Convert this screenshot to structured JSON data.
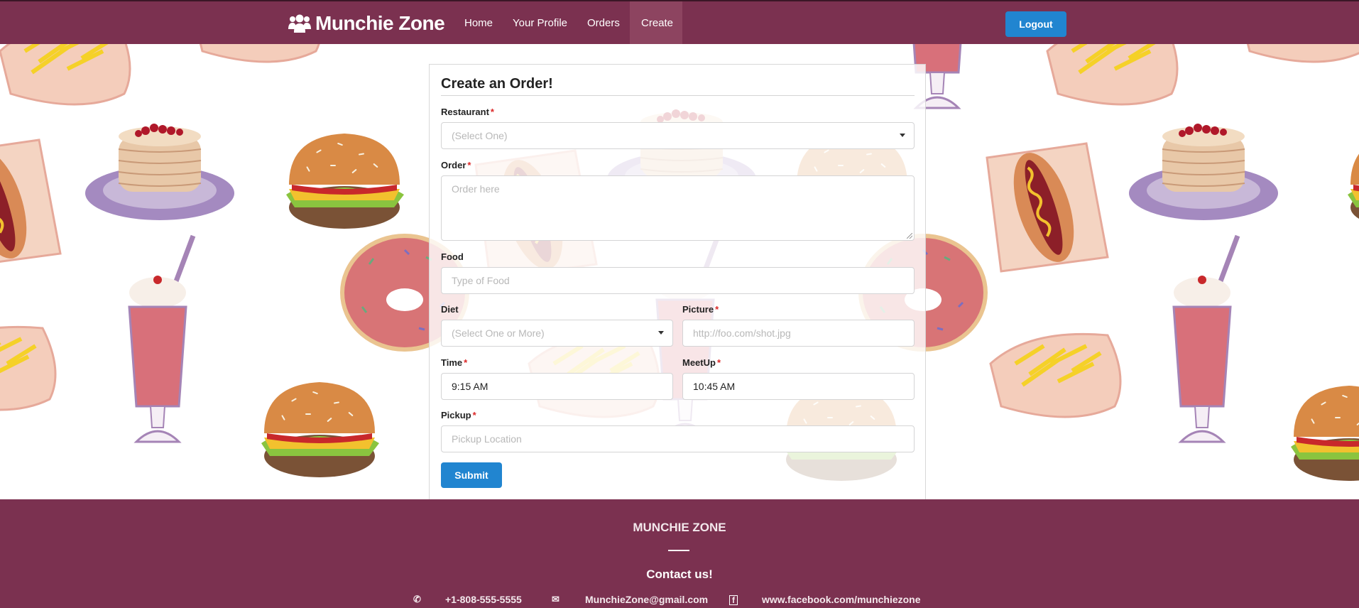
{
  "header": {
    "brand": "Munchie Zone",
    "nav": [
      "Home",
      "Your Profile",
      "Orders",
      "Create"
    ],
    "active_nav": "Create",
    "logout_label": "Logout"
  },
  "form": {
    "title": "Create an Order!",
    "restaurant": {
      "label": "Restaurant",
      "placeholder": "(Select One)"
    },
    "order": {
      "label": "Order",
      "placeholder": "Order here"
    },
    "food": {
      "label": "Food",
      "placeholder": "Type of Food"
    },
    "diet": {
      "label": "Diet",
      "placeholder": "(Select One or More)"
    },
    "picture": {
      "label": "Picture",
      "placeholder": "http://foo.com/shot.jpg"
    },
    "time": {
      "label": "Time",
      "value": "9:15 AM"
    },
    "meetup": {
      "label": "MeetUp",
      "value": "10:45 AM"
    },
    "pickup": {
      "label": "Pickup",
      "placeholder": "Pickup Location"
    },
    "required_marker": "*",
    "submit_label": "Submit"
  },
  "footer": {
    "name": "MUNCHIE ZONE",
    "contact_heading": "Contact us!",
    "phone": "+1-808-555-5555",
    "email": "MunchieZone@gmail.com",
    "facebook": "www.facebook.com/munchiezone"
  },
  "colors": {
    "header_bg": "#7b3150",
    "button_blue": "#2185d0",
    "required_red": "#db2828"
  },
  "icons": {
    "brand": "users-icon",
    "phone": "phone-icon",
    "email": "envelope-icon",
    "facebook": "facebook-icon"
  }
}
